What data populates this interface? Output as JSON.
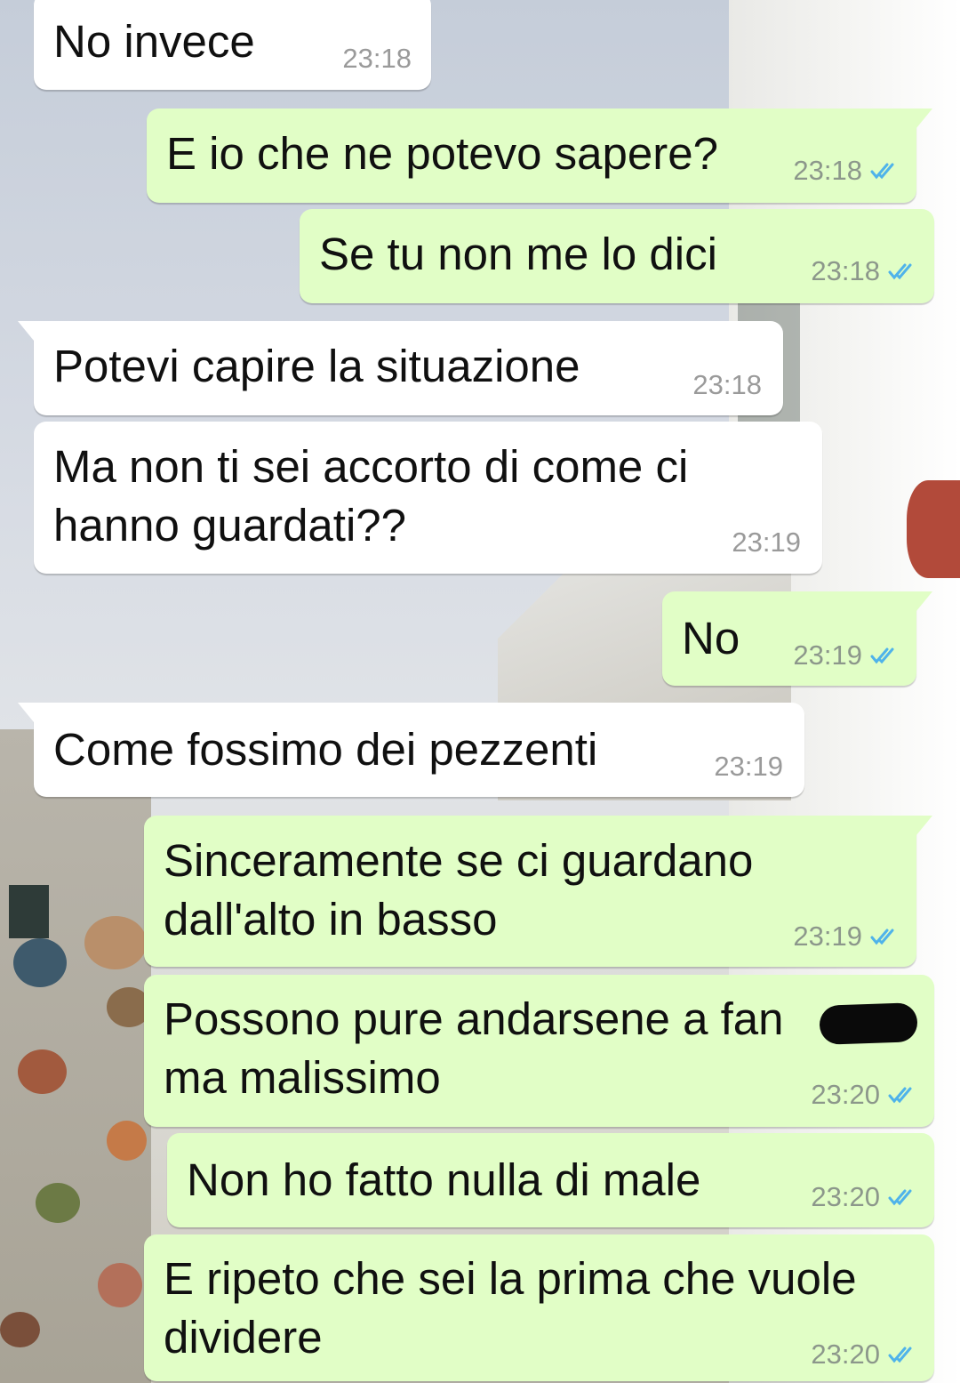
{
  "theme": {
    "incoming_bubble": "#ffffff",
    "outgoing_bubble": "#e1fec6",
    "read_ticks": "#4fb3ea",
    "time_color": "#8c978b"
  },
  "messages": [
    {
      "dir": "in",
      "text": "No invece",
      "time": "23:18"
    },
    {
      "dir": "out",
      "text": "E io che ne potevo sapere?",
      "time": "23:18",
      "status": "read"
    },
    {
      "dir": "out",
      "text": "Se tu non me lo dici",
      "time": "23:18",
      "status": "read"
    },
    {
      "dir": "in",
      "text": "Potevi capire la situazione",
      "time": "23:18"
    },
    {
      "dir": "in",
      "lines": [
        "Ma non ti sei accorto di come ci",
        "hanno guardati??"
      ],
      "time": "23:19"
    },
    {
      "dir": "out",
      "text": "No",
      "time": "23:19",
      "status": "read"
    },
    {
      "dir": "in",
      "text": "Come fossimo dei pezzenti",
      "time": "23:19"
    },
    {
      "dir": "out",
      "lines": [
        "Sinceramente se ci guardano",
        "dall'alto in basso"
      ],
      "time": "23:19",
      "status": "read"
    },
    {
      "dir": "out",
      "lines": [
        "Possono pure andarsene a fan",
        "ma malissimo"
      ],
      "time": "23:20",
      "status": "read",
      "redacted": true
    },
    {
      "dir": "out",
      "text": "Non ho fatto nulla di male",
      "time": "23:20",
      "status": "read"
    },
    {
      "dir": "out",
      "lines": [
        "E ripeto che sei la prima che vuole",
        "dividere"
      ],
      "time": "23:20",
      "status": "read"
    }
  ]
}
